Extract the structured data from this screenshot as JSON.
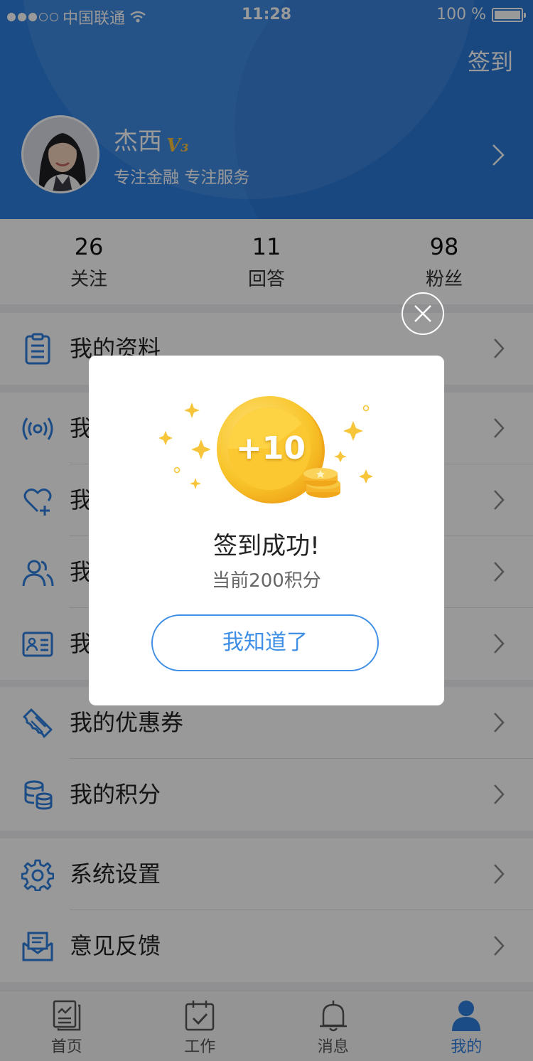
{
  "status_bar": {
    "carrier": "中国联通",
    "time": "11:28",
    "battery": "100 %"
  },
  "header": {
    "checkin_label": "签到",
    "name": "杰西",
    "badge": "V₃",
    "motto": "专注金融 专注服务"
  },
  "stats": [
    {
      "value": "26",
      "label": "关注"
    },
    {
      "value": "11",
      "label": "回答"
    },
    {
      "value": "98",
      "label": "粉丝"
    }
  ],
  "menu": [
    {
      "label": "我的资料",
      "icon": "clipboard-icon"
    },
    {
      "label": "我",
      "icon": "broadcast-icon"
    },
    {
      "label": "我",
      "icon": "heart-plus-icon"
    },
    {
      "label": "我",
      "icon": "users-icon"
    },
    {
      "label": "我",
      "icon": "id-card-icon"
    },
    {
      "label": "我的优惠券",
      "icon": "ticket-icon"
    },
    {
      "label": "我的积分",
      "icon": "coins-icon"
    },
    {
      "label": "系统设置",
      "icon": "gear-icon"
    },
    {
      "label": "意见反馈",
      "icon": "mail-icon"
    }
  ],
  "tabs": [
    {
      "label": "首页",
      "icon": "home-doc-icon"
    },
    {
      "label": "工作",
      "icon": "calendar-check-icon"
    },
    {
      "label": "消息",
      "icon": "bell-icon"
    },
    {
      "label": "我的",
      "icon": "person-icon"
    }
  ],
  "dialog": {
    "coin_text": "+10",
    "title": "签到成功!",
    "subtitle": "当前200积分",
    "button": "我知道了"
  },
  "colors": {
    "primary": "#2f7fe0",
    "accent_gold": "#f5c242",
    "dialog_button": "#3f8fe6"
  }
}
